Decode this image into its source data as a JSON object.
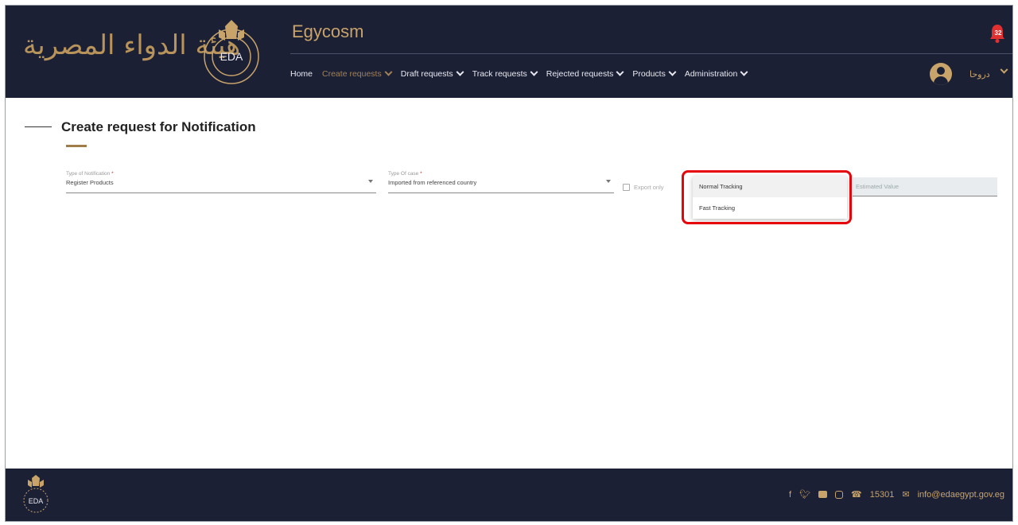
{
  "brand": {
    "arabic_name": "هيئة الدواء المصرية",
    "emblem_text": "EDA",
    "app_title": "Egycosm"
  },
  "nav": {
    "items": [
      {
        "label": "Home",
        "has_menu": false,
        "active": false
      },
      {
        "label": "Create requests",
        "has_menu": true,
        "active": true
      },
      {
        "label": "Draft requests",
        "has_menu": true,
        "active": false
      },
      {
        "label": "Track requests",
        "has_menu": true,
        "active": false
      },
      {
        "label": "Rejected requests",
        "has_menu": true,
        "active": false
      },
      {
        "label": "Products",
        "has_menu": true,
        "active": false
      },
      {
        "label": "Administration",
        "has_menu": true,
        "active": false
      }
    ]
  },
  "header": {
    "notification_count": "32",
    "user_name": "دروحا"
  },
  "page": {
    "title": "Create request for Notification"
  },
  "form": {
    "type_of_notification": {
      "label": "Type of Notification",
      "value": "Register Products"
    },
    "type_of_case": {
      "label": "Type Of case",
      "value": "Imported from referenced country"
    },
    "export_only": {
      "label": "Export only",
      "checked": false
    },
    "estimated_value": {
      "placeholder": "Estimated Value",
      "value": ""
    }
  },
  "tracking_dropdown": {
    "options": [
      "Normal Tracking",
      "Fast Tracking"
    ],
    "highlighted": "Normal Tracking"
  },
  "footer": {
    "phone": "15301",
    "email": "info@edaegypt.gov.eg"
  },
  "colors": {
    "header_bg": "#1c2035",
    "accent_gold": "#c8a36a",
    "active_nav": "#a08257",
    "highlight_red": "#e5050a",
    "notification_red": "#e03030"
  }
}
